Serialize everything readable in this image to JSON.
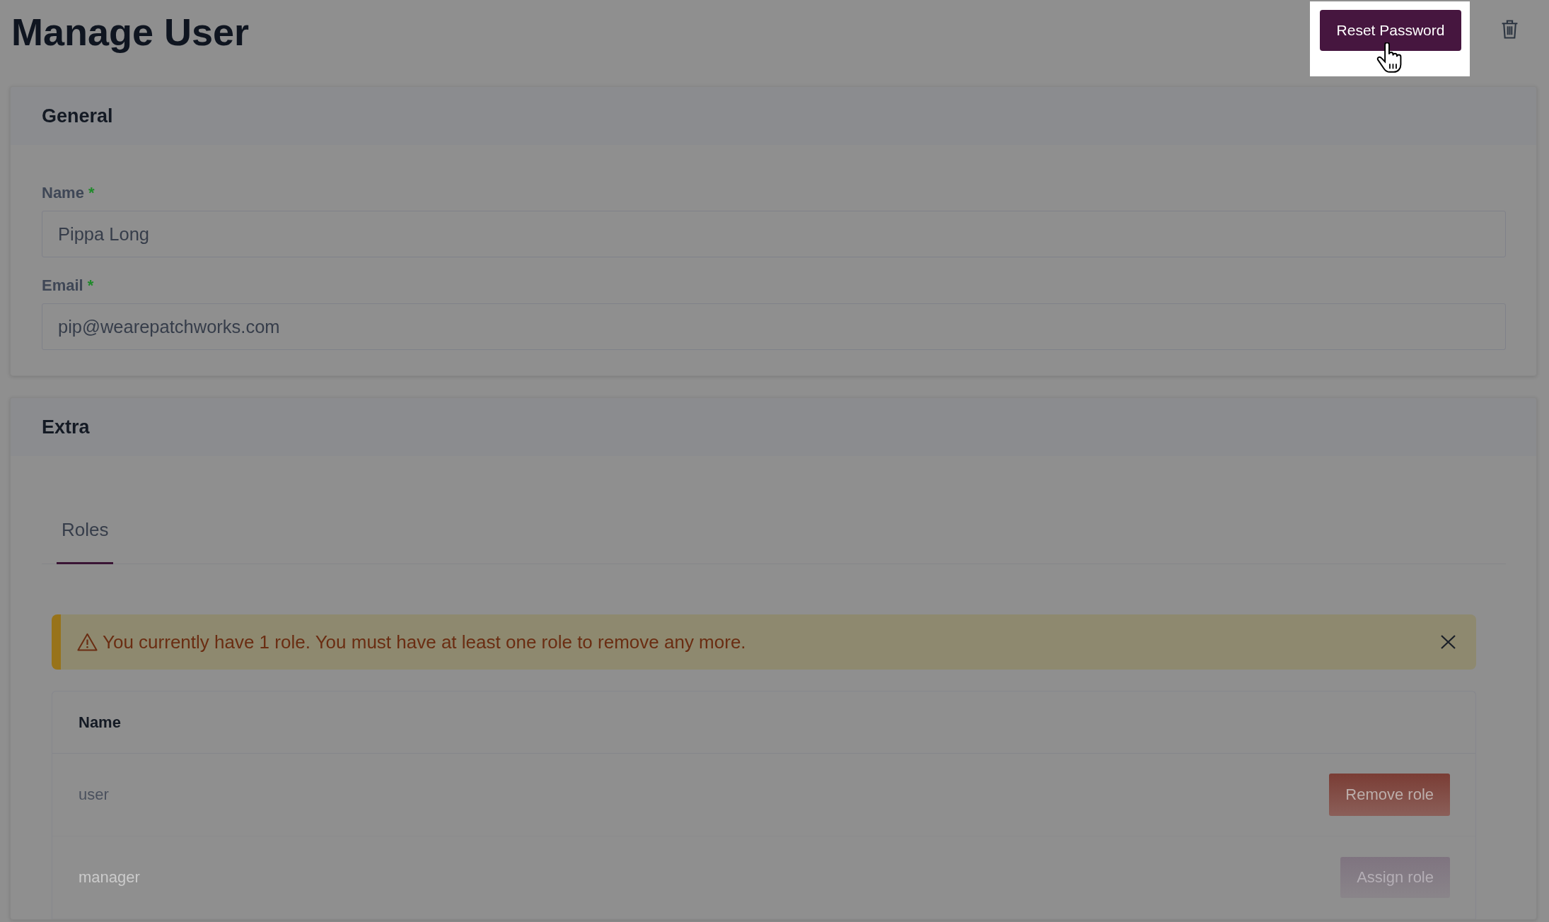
{
  "page": {
    "title": "Manage User"
  },
  "header_actions": {
    "reset_button": {
      "label": "Reset Password",
      "highlighted": true
    }
  },
  "general": {
    "title": "General",
    "fields": [
      {
        "label": "Name",
        "required_mark": "*",
        "value": "Pippa Long"
      },
      {
        "label": "Email",
        "required_mark": "*",
        "value": "pip@wearepatchworks.com"
      }
    ]
  },
  "extra": {
    "title": "Extra",
    "tabs": [
      {
        "label": "Roles",
        "selected": true
      }
    ],
    "alert": {
      "kind": "warning",
      "message": "You currently have 1 role. You must have at least one role to remove any more."
    },
    "roles_table": {
      "columns": [
        "Name"
      ],
      "rows": [
        {
          "name": "user",
          "dimmed": false,
          "action": {
            "kind": "remove",
            "label": "Remove role"
          }
        },
        {
          "name": "manager",
          "dimmed": true,
          "action": {
            "kind": "assign",
            "label": "Assign role"
          }
        }
      ]
    }
  }
}
